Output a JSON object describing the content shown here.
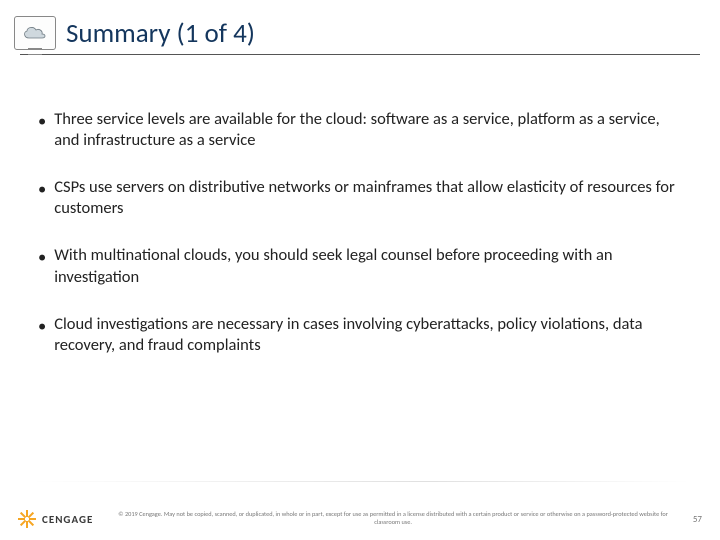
{
  "header": {
    "title": "Summary (1 of 4)"
  },
  "bullets": [
    "Three service levels are available for the cloud: software as a service, platform as a service, and infrastructure as a service",
    "CSPs use servers on distributive networks or mainframes that allow elasticity of resources for customers",
    "With multinational clouds, you should seek legal counsel before proceeding with an investigation",
    "Cloud investigations are necessary in cases involving cyberattacks, policy violations, data recovery, and fraud complaints"
  ],
  "footer": {
    "brand": "CENGAGE",
    "copyright": "© 2019 Cengage. May not be copied, scanned, or duplicated, in whole or in part, except for use as permitted in a license distributed with a certain product or service or otherwise on a password-protected website for classroom use.",
    "page": "57"
  }
}
